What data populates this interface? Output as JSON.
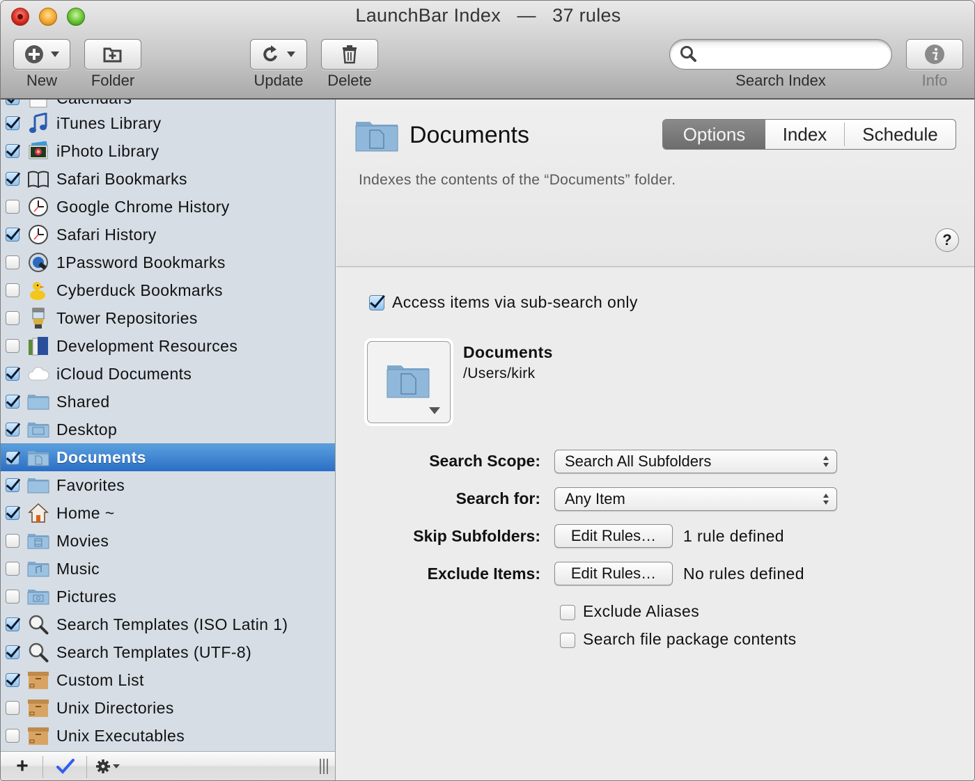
{
  "window": {
    "title": "LaunchBar Index",
    "title_separator": "—",
    "rule_count_label": "37 rules"
  },
  "toolbar": {
    "new_label": "New",
    "folder_label": "Folder",
    "update_label": "Update",
    "delete_label": "Delete",
    "search_label": "Search Index",
    "search_value": "",
    "search_placeholder": "",
    "info_label": "Info"
  },
  "sidebar": {
    "partial_top_item": "Calendars",
    "items": [
      {
        "label": "iTunes Library",
        "checked": true,
        "icon": "music-note-icon"
      },
      {
        "label": "iPhoto Library",
        "checked": true,
        "icon": "iphoto-icon"
      },
      {
        "label": "Safari Bookmarks",
        "checked": true,
        "icon": "book-icon"
      },
      {
        "label": "Google Chrome History",
        "checked": false,
        "icon": "clock-icon"
      },
      {
        "label": "Safari History",
        "checked": true,
        "icon": "clock-icon"
      },
      {
        "label": "1Password Bookmarks",
        "checked": false,
        "icon": "1password-icon"
      },
      {
        "label": "Cyberduck Bookmarks",
        "checked": false,
        "icon": "duck-icon"
      },
      {
        "label": "Tower Repositories",
        "checked": false,
        "icon": "tower-icon"
      },
      {
        "label": "Development Resources",
        "checked": false,
        "icon": "books-icon"
      },
      {
        "label": "iCloud Documents",
        "checked": true,
        "icon": "cloud-icon"
      },
      {
        "label": "Shared",
        "checked": true,
        "icon": "folder-icon"
      },
      {
        "label": "Desktop",
        "checked": true,
        "icon": "desktop-folder-icon"
      },
      {
        "label": "Documents",
        "checked": true,
        "icon": "documents-folder-icon",
        "selected": true
      },
      {
        "label": "Favorites",
        "checked": true,
        "icon": "folder-icon"
      },
      {
        "label": "Home ~",
        "checked": true,
        "icon": "home-icon"
      },
      {
        "label": "Movies",
        "checked": false,
        "icon": "movies-folder-icon"
      },
      {
        "label": "Music",
        "checked": false,
        "icon": "music-folder-icon"
      },
      {
        "label": "Pictures",
        "checked": false,
        "icon": "pictures-folder-icon"
      },
      {
        "label": "Search Templates (ISO Latin 1)",
        "checked": true,
        "icon": "magnifier-icon"
      },
      {
        "label": "Search Templates (UTF-8)",
        "checked": true,
        "icon": "magnifier-icon"
      },
      {
        "label": "Custom List",
        "checked": true,
        "icon": "box-icon"
      },
      {
        "label": "Unix Directories",
        "checked": false,
        "icon": "box-icon"
      },
      {
        "label": "Unix Executables",
        "checked": false,
        "icon": "box-icon"
      }
    ],
    "bottom": {
      "add_glyph": "+",
      "check_glyph": "✓"
    }
  },
  "detail": {
    "title": "Documents",
    "tabs": [
      {
        "label": "Options",
        "active": true
      },
      {
        "label": "Index",
        "active": false
      },
      {
        "label": "Schedule",
        "active": false
      }
    ],
    "description": "Indexes the contents of the “Documents” folder.",
    "help_glyph": "?",
    "sub_search": {
      "label": "Access items via sub-search only",
      "checked": true
    },
    "location": {
      "name": "Documents",
      "path": "/Users/kirk"
    },
    "search_scope": {
      "label": "Search Scope:",
      "value": "Search All Subfolders"
    },
    "search_for": {
      "label": "Search for:",
      "value": "Any Item"
    },
    "skip_subfolders": {
      "label": "Skip Subfolders:",
      "button": "Edit Rules…",
      "status": "1 rule defined"
    },
    "exclude_items": {
      "label": "Exclude Items:",
      "button": "Edit Rules…",
      "status": "No rules defined"
    },
    "exclude_aliases": {
      "label": "Exclude Aliases",
      "checked": false
    },
    "search_packages": {
      "label": "Search file package contents",
      "checked": false
    }
  },
  "colors": {
    "selection": "#3a7fd0",
    "sidebar_bg": "#d6dde5",
    "pane_bg": "#ececec",
    "check_blue": "#2f5ef0"
  }
}
